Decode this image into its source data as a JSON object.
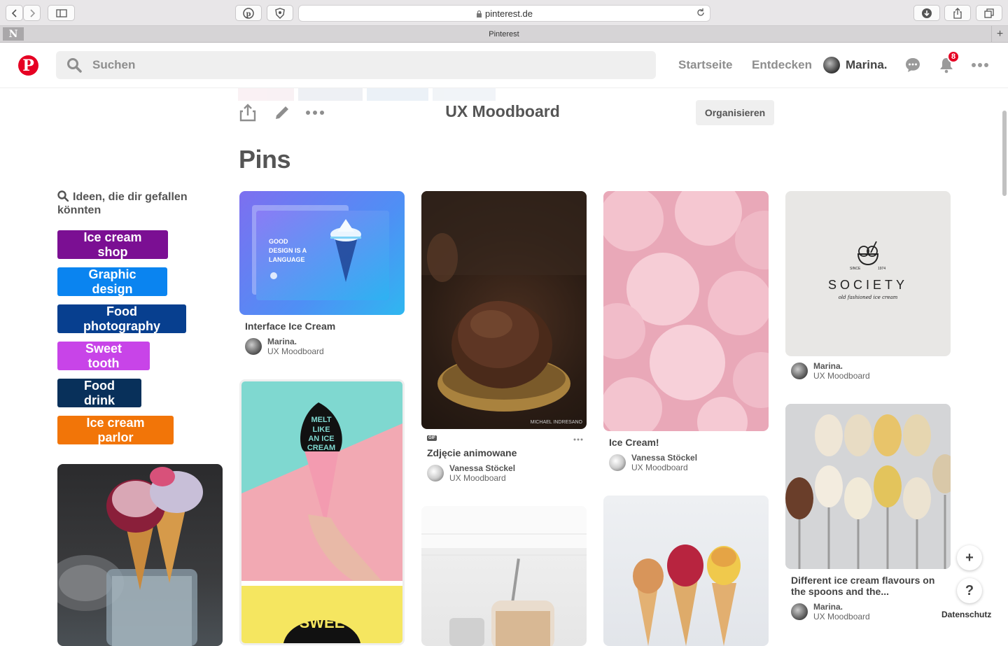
{
  "browser": {
    "url": "pinterest.de",
    "tab_title": "Pinterest",
    "tab_favicon": "N"
  },
  "header": {
    "logo": "P",
    "search_placeholder": "Suchen",
    "nav_home": "Startseite",
    "nav_explore": "Entdecken",
    "user_name": "Marina.",
    "notification_count": "8"
  },
  "board": {
    "title": "UX Moodboard",
    "organize_label": "Organisieren",
    "pins_heading": "Pins"
  },
  "ideas": {
    "heading": "Ideen, die dir gefallen könnten",
    "items": [
      {
        "label": "Ice cream shop",
        "color": "#7b0f93"
      },
      {
        "label": "Graphic design",
        "color": "#0a84f0"
      },
      {
        "label": "Food photography",
        "color": "#073f8f"
      },
      {
        "label": "Sweet tooth",
        "color": "#c844e8"
      },
      {
        "label": "Food drink",
        "color": "#08305a"
      },
      {
        "label": "Ice cream parlor",
        "color": "#f27508"
      }
    ]
  },
  "pins": [
    {
      "title": "Interface Ice Cream",
      "user": "Marina.",
      "board": "UX Moodboard",
      "image_text": [
        "GOOD",
        "DESIGN IS A",
        "LANGUAGE"
      ]
    },
    {
      "title": "Zdjęcie animowane",
      "user": "Vanessa Stöckel",
      "board": "UX Moodboard",
      "gif_label": "GIF",
      "watermark": "MICHAEL INDRESANO"
    },
    {
      "title": "Ice Cream!",
      "user": "Vanessa Stöckel",
      "board": "UX Moodboard"
    },
    {
      "title": "",
      "user": "Marina.",
      "board": "UX Moodboard",
      "logo_since": "SINCE",
      "logo_year": "1974",
      "logo_name": "SOCIETY",
      "logo_tagline": "old fashioned ice cream"
    },
    {
      "title": "",
      "image_text": [
        "MELT",
        "LIKE",
        "AN ICE",
        "CREAM"
      ]
    },
    {
      "title": "Different ice cream flavours on the spoons and the...",
      "user": "Marina.",
      "board": "UX Moodboard"
    }
  ],
  "partial_pin_text": "SWEE",
  "footer": {
    "privacy": "Datenschutz",
    "add": "+",
    "help": "?"
  }
}
